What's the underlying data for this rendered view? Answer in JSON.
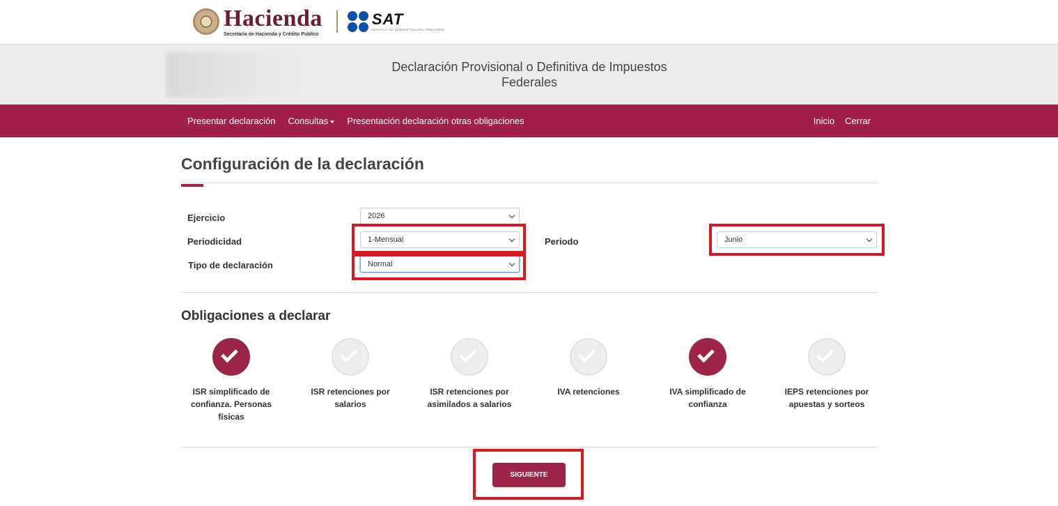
{
  "header": {
    "brand_name": "Hacienda",
    "brand_subtitle": "Secretaría de Hacienda y Crédito Público",
    "sat_name": "SAT",
    "sat_subtitle": "SERVICIO DE ADMINISTRACIÓN TRIBUTARIA"
  },
  "band": {
    "title": "Declaración Provisional o Definitiva de Impuestos Federales"
  },
  "nav": {
    "left": [
      {
        "label": "Presentar declaración"
      },
      {
        "label": "Consultas"
      },
      {
        "label": "Presentación declaración otras obligaciones"
      }
    ],
    "right": [
      {
        "label": "Inicio"
      },
      {
        "label": "Cerrar"
      }
    ]
  },
  "form": {
    "section_title": "Configuración de la declaración",
    "ejercicio": {
      "label": "Ejercicio",
      "value": "2026"
    },
    "periodicidad": {
      "label": "Periodicidad",
      "value": "1-Mensual"
    },
    "periodo": {
      "label": "Periodo",
      "value": "Junio"
    },
    "tipo": {
      "label": "Tipo de declaración",
      "value": "Normal"
    }
  },
  "obligaciones": {
    "title": "Obligaciones a declarar",
    "items": [
      {
        "label": "ISR simplificado de confianza. Personas físicas",
        "selected": true
      },
      {
        "label": "ISR retenciones por salarios",
        "selected": false
      },
      {
        "label": "ISR retenciones por asimilados a salarios",
        "selected": false
      },
      {
        "label": "IVA retenciones",
        "selected": false
      },
      {
        "label": "IVA simplificado de confianza",
        "selected": true
      },
      {
        "label": "IEPS retenciones por apuestas y sorteos",
        "selected": false
      }
    ]
  },
  "actions": {
    "next_label": "SIGUIENTE"
  },
  "colors": {
    "brand": "#9d2449",
    "nav_bg": "#a0204a",
    "highlight": "#d9181f"
  }
}
